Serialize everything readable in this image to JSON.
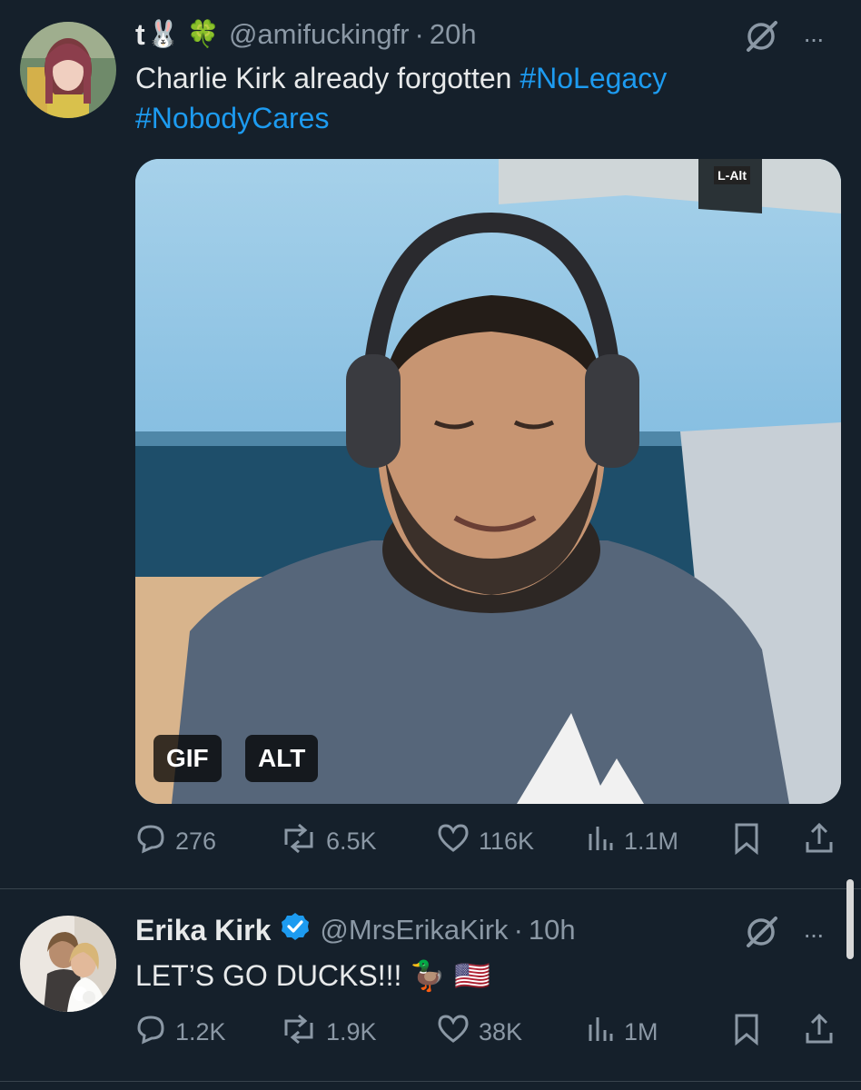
{
  "tweets": [
    {
      "display_name": "t",
      "emoji": "🐰 🍀",
      "handle": "@amifuckingfr",
      "time": "20h",
      "text": "Charlie Kirk already forgotten",
      "hashtags": [
        "#NoLegacy",
        "#NobodyCares"
      ],
      "media": {
        "gif_label": "GIF",
        "alt_label": "ALT",
        "overlay_text": "L-Alt"
      },
      "stats": {
        "replies": "276",
        "reposts": "6.5K",
        "likes": "116K",
        "views": "1.1M"
      }
    },
    {
      "display_name": "Erika Kirk",
      "handle": "@MrsErikaKirk",
      "time": "10h",
      "text": "LET’S GO DUCKS!!! 🦆 🇺🇸",
      "stats": {
        "replies": "1.2K",
        "reposts": "1.9K",
        "likes": "38K",
        "views": "1M"
      }
    }
  ],
  "separator": "·",
  "more": "···",
  "icons": [
    "grok-icon",
    "more-icon",
    "reply-icon",
    "repost-icon",
    "like-icon",
    "views-icon",
    "bookmark-icon",
    "share-icon",
    "verified-icon"
  ],
  "colors": {
    "background": "#15202b",
    "accent": "#1d9bf0",
    "muted": "#8b98a5",
    "text": "#e7e9ea"
  }
}
